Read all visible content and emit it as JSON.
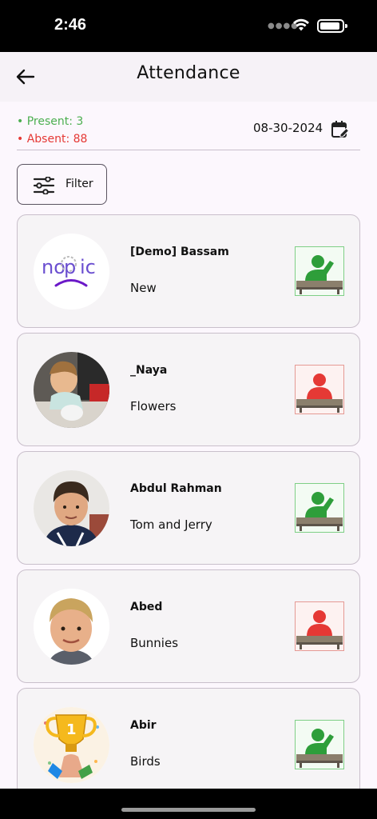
{
  "status_bar": {
    "time": "2:46"
  },
  "header": {
    "title": "Attendance"
  },
  "summary": {
    "present": "• Present: 3",
    "absent": "• Absent: 88"
  },
  "date": "08-30-2024",
  "filter": {
    "label": "Filter"
  },
  "colors": {
    "present": "#4caf50",
    "absent": "#e53935",
    "background": "#fcf7fd"
  },
  "students": [
    {
      "name": "[Demo] Bassam",
      "group": "New",
      "status": "present",
      "avatar": "nopic-logo"
    },
    {
      "name": "_Naya",
      "group": "Flowers",
      "status": "absent",
      "avatar": "child-photo"
    },
    {
      "name": "Abdul Rahman",
      "group": "Tom and Jerry",
      "status": "present",
      "avatar": "child-photo"
    },
    {
      "name": "Abed",
      "group": "Bunnies",
      "status": "absent",
      "avatar": "child-photo"
    },
    {
      "name": "Abir",
      "group": "Birds",
      "status": "present",
      "avatar": "trophy-image"
    }
  ]
}
